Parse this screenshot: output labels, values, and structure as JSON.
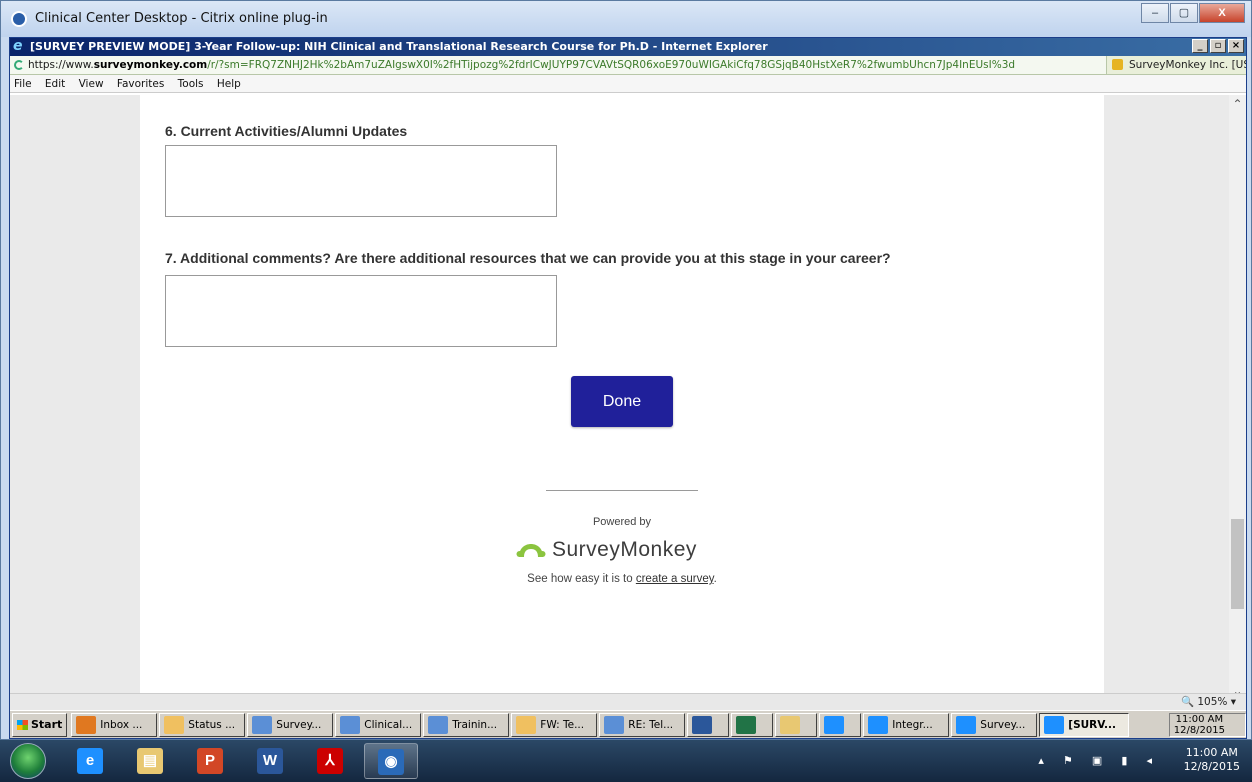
{
  "citrix": {
    "title": "Clinical Center Desktop - Citrix online plug-in",
    "buttons": [
      "–",
      "▢",
      "X"
    ]
  },
  "browser": {
    "title": "[SURVEY PREVIEW MODE] 3-Year Follow-up: NIH Clinical and Translational Research Course for Ph.D - Internet Explorer",
    "controls": [
      "_",
      "▫",
      "×"
    ],
    "url_scheme": "https://www.",
    "url_domain": "surveymonkey.com",
    "url_rest": "/r/?sm=FRQ7ZNHJ2Hk%2bAm7uZAIgswX0I%2fHTijpozg%2fdrICwJUYP97CVAVtSQR06xoE970uWIGAkiCfq78GSjqB40HstXeR7%2fwumbUhcn7Jp4InEUsI%3d",
    "cert": "SurveyMonkey Inc. [US]",
    "menu": [
      "File",
      "Edit",
      "View",
      "Favorites",
      "Tools",
      "Help"
    ],
    "zoom": "105%"
  },
  "survey": {
    "q6": "6. Current Activities/Alumni Updates",
    "q7": "7. Additional comments? Are there additional resources that we can provide you at this stage in your career?",
    "done": "Done",
    "powered_by": "Powered by",
    "brand": "SurveyMonkey",
    "see_how_prefix": "See how easy it is to ",
    "see_how_link": "create a survey",
    "see_how_suffix": "."
  },
  "xp_taskbar": {
    "start": "Start",
    "items": [
      {
        "label": "Inbox ...",
        "icon": "outlook-icon",
        "color": "#e07820"
      },
      {
        "label": "Status ...",
        "icon": "envelope-icon",
        "color": "#f0c060"
      },
      {
        "label": "Survey...",
        "icon": "document-icon",
        "color": "#5b8fd6"
      },
      {
        "label": "Clinical...",
        "icon": "document-icon",
        "color": "#5b8fd6"
      },
      {
        "label": "Trainin...",
        "icon": "document-icon",
        "color": "#5b8fd6"
      },
      {
        "label": "FW: Te...",
        "icon": "envelope-icon",
        "color": "#f0c060"
      },
      {
        "label": "RE: Tel...",
        "icon": "document-icon",
        "color": "#5b8fd6"
      },
      {
        "label": "",
        "icon": "word-icon",
        "color": "#2b579a"
      },
      {
        "label": "",
        "icon": "excel-icon",
        "color": "#217346"
      },
      {
        "label": "",
        "icon": "folder-icon",
        "color": "#e8c872"
      },
      {
        "label": "",
        "icon": "ie-icon",
        "color": "#1e90ff"
      },
      {
        "label": "Integr...",
        "icon": "ie-icon",
        "color": "#1e90ff"
      },
      {
        "label": "Survey...",
        "icon": "ie-icon",
        "color": "#1e90ff"
      },
      {
        "label": "[SURV...",
        "icon": "ie-icon",
        "color": "#1e90ff",
        "active": true
      }
    ],
    "time": "11:00 AM",
    "date": "12/8/2015"
  },
  "win7_taskbar": {
    "pins": [
      {
        "icon": "ie-icon",
        "glyph": "e",
        "color": "#1e90ff"
      },
      {
        "icon": "folder-icon",
        "glyph": "▤",
        "color": "#e8c872"
      },
      {
        "icon": "powerpoint-icon",
        "glyph": "P",
        "color": "#d24726"
      },
      {
        "icon": "word-icon",
        "glyph": "W",
        "color": "#2b579a"
      },
      {
        "icon": "acrobat-icon",
        "glyph": "⅄",
        "color": "#c00"
      },
      {
        "icon": "citrix-icon",
        "glyph": "◉",
        "color": "#2a6ab8",
        "active": true
      }
    ],
    "time": "11:00 AM",
    "date": "12/8/2015"
  }
}
